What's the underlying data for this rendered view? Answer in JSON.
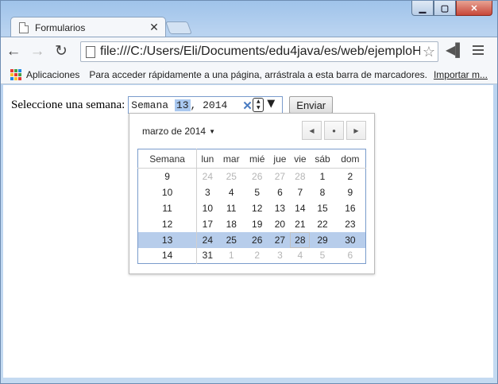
{
  "tab": {
    "title": "Formularios"
  },
  "toolbar": {
    "url": "file:///C:/Users/Eli/Documents/edu4java/es/web/ejemploH"
  },
  "bookmarks": {
    "apps_label": "Aplicaciones",
    "hint": "Para acceder rápidamente a una página, arrástrala a esta barra de marcadores.",
    "import_link": "Importar m..."
  },
  "form": {
    "label": "Seleccione una semana:",
    "input_prefix": "Semana ",
    "input_week": "13",
    "input_suffix": ", 2014",
    "submit_label": "Enviar"
  },
  "picker": {
    "month_label": "marzo de 2014",
    "headers": [
      "Semana",
      "lun",
      "mar",
      "mié",
      "jue",
      "vie",
      "sáb",
      "dom"
    ],
    "rows": [
      {
        "week": "9",
        "days": [
          "24",
          "25",
          "26",
          "27",
          "28",
          "1",
          "2"
        ]
      },
      {
        "week": "10",
        "days": [
          "3",
          "4",
          "5",
          "6",
          "7",
          "8",
          "9"
        ]
      },
      {
        "week": "11",
        "days": [
          "10",
          "11",
          "12",
          "13",
          "14",
          "15",
          "16"
        ]
      },
      {
        "week": "12",
        "days": [
          "17",
          "18",
          "19",
          "20",
          "21",
          "22",
          "23"
        ]
      },
      {
        "week": "13",
        "days": [
          "24",
          "25",
          "26",
          "27",
          "28",
          "29",
          "30"
        ]
      },
      {
        "week": "14",
        "days": [
          "31",
          "1",
          "2",
          "3",
          "4",
          "5",
          "6"
        ]
      }
    ],
    "selected_week": "13"
  }
}
